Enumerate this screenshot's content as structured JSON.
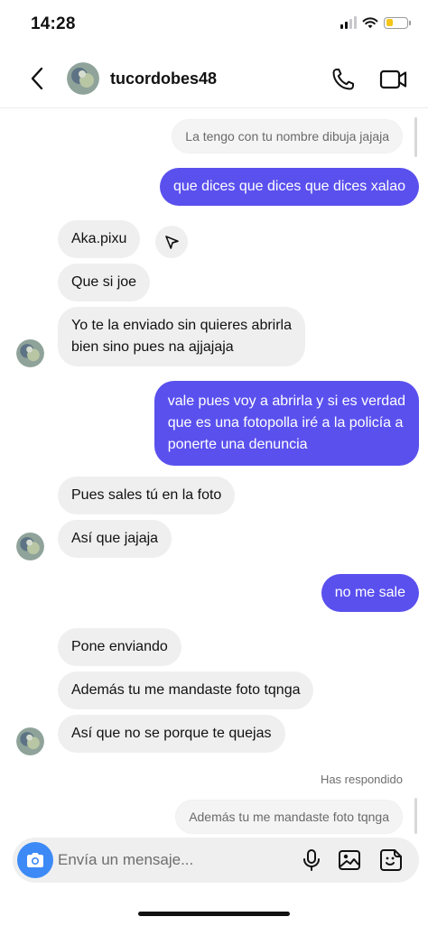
{
  "status_bar": {
    "time": "14:28"
  },
  "header": {
    "username": "tucordobes48",
    "icons": [
      "back-chevron-icon",
      "phone-icon",
      "video-camera-icon"
    ]
  },
  "messages": [
    {
      "kind": "reply_preview",
      "text": "La tengo con tu nombre dibuja jajaja"
    },
    {
      "kind": "outgoing",
      "lines": [
        "que dices que dices que dices xalao"
      ]
    },
    {
      "kind": "incoming",
      "lines": [
        "Aka.pixu"
      ]
    },
    {
      "kind": "incoming",
      "lines": [
        "Que si joe"
      ]
    },
    {
      "kind": "incoming",
      "lines": [
        "Yo te la enviado sin quieres abrirla",
        "bien sino pues na ajjajaja"
      ]
    },
    {
      "kind": "outgoing",
      "lines": [
        "vale pues voy a abrirla y si es verdad",
        "que es una fotopolla iré a la policía a",
        "ponerte una denuncia"
      ]
    },
    {
      "kind": "incoming",
      "lines": [
        "Pues sales tú en la foto"
      ]
    },
    {
      "kind": "incoming",
      "lines": [
        "Así que jajaja"
      ]
    },
    {
      "kind": "outgoing",
      "lines": [
        "no me sale"
      ]
    },
    {
      "kind": "incoming",
      "lines": [
        "Pone enviando"
      ]
    },
    {
      "kind": "incoming",
      "lines": [
        "Además tu me mandaste foto tqnga"
      ]
    },
    {
      "kind": "incoming",
      "lines": [
        "Así que no se porque te quejas"
      ]
    },
    {
      "kind": "system",
      "text": "Has respondido"
    },
    {
      "kind": "reply_preview",
      "text": "Además tu me mandaste foto tqnga"
    }
  ],
  "composer": {
    "placeholder": "Envía un mensaje...",
    "value": ""
  },
  "colors": {
    "outgoing_bubble": "#5a50ee",
    "incoming_bubble": "#efefef",
    "camera_button": "#3d8af7",
    "battery": "#f5c518"
  }
}
